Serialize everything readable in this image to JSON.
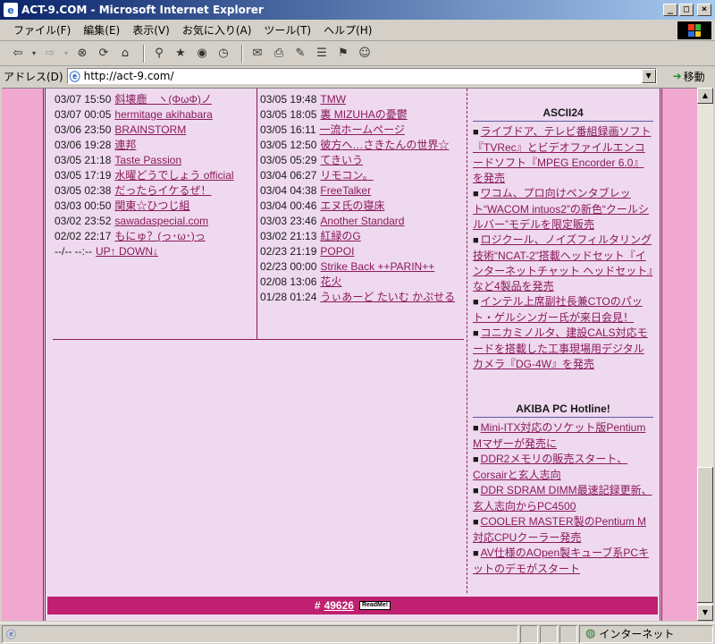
{
  "window": {
    "title": "ACT-9.COM - Microsoft Internet Explorer",
    "icon": "e"
  },
  "menu": [
    "ファイル(F)",
    "編集(E)",
    "表示(V)",
    "お気に入り(A)",
    "ツール(T)",
    "ヘルプ(H)"
  ],
  "address": {
    "label": "アドレス(D)",
    "url": "http://act-9.com/",
    "go_label": "移動"
  },
  "left_list": [
    {
      "date": "03/07 15:50",
      "link": "斜壊鹿　ヽ(ΦωΦ)ノ"
    },
    {
      "date": "03/07 00:05",
      "link": "hermitage akihabara"
    },
    {
      "date": "03/06 23:50",
      "link": "BRAINSTORM"
    },
    {
      "date": "03/06 19:28",
      "link": "連邦"
    },
    {
      "date": "03/05 21:18",
      "link": "Taste Passion"
    },
    {
      "date": "03/05 17:19",
      "link": "水曜どうでしょう official"
    },
    {
      "date": "03/05 02:38",
      "link": "だったらイケるぜ！"
    },
    {
      "date": "03/03 00:50",
      "link": "関東☆ひつじ組"
    },
    {
      "date": "03/02 23:52",
      "link": "sawadaspecial.com"
    },
    {
      "date": "02/02 22:17",
      "link": "もにゅ？(っ･ω･)っ"
    },
    {
      "date": "--/-- --:--",
      "link": "UP↑ DOWN↓"
    }
  ],
  "mid_list": [
    {
      "date": "03/05 19:48",
      "link": "TMW"
    },
    {
      "date": "03/05 18:05",
      "link": "裏 MIZUHAの憂鬱"
    },
    {
      "date": "03/05 16:11",
      "link": "一流ホームページ"
    },
    {
      "date": "03/05 12:50",
      "link": "彼方へ…さきたんの世界☆"
    },
    {
      "date": "03/05 05:29",
      "link": "てきいう"
    },
    {
      "date": "03/04 06:27",
      "link": "リモコン。"
    },
    {
      "date": "03/04 04:38",
      "link": "FreeTalker"
    },
    {
      "date": "03/04 00:46",
      "link": "エヌ氏の寝床"
    },
    {
      "date": "03/03 23:46",
      "link": "Another Standard"
    },
    {
      "date": "03/02 21:13",
      "link": "紅緑のG"
    },
    {
      "date": "02/23 21:19",
      "link": "POPOI"
    },
    {
      "date": "02/23 00:00",
      "link": "Strike Back ++PARIN++"
    },
    {
      "date": "02/08 13:06",
      "link": "花火"
    },
    {
      "date": "01/28 01:24",
      "link": "うぃあーど たいむ かぷせる"
    }
  ],
  "ascii24": {
    "title": "ASCII24",
    "items": [
      "ライブドア、テレビ番組録画ソフト『TVRec』とビデオファイルエンコードソフト『MPEG Encorder 6.0』を発売",
      "ワコム、プロ向けペンタブレット“WACOM intuos2”の新色“クールシルバー”モデルを限定販売",
      "ロジクール、ノイズフィルタリング技術“NCAT-2”搭載ヘッドセット『インターネットチャット ヘッドセット』など4製品を発売",
      "インテル上席副社長兼CTOのパット・ゲルシンガー氏が来日会見！",
      "コニカミノルタ、建設CALS対応モードを搭載した工事現場用デジタルカメラ『DG-4W』を発売"
    ]
  },
  "akiba": {
    "title": "AKIBA PC Hotline!",
    "items": [
      "Mini-ITX対応のソケット版Pentium Mマザーが発売に",
      "DDR2メモリの販売スタート、Corsairと玄人志向",
      "DDR SDRAM DIMM最速記録更新、玄人志向からPC4500",
      "COOLER MASTER製のPentium M対応CPUクーラー発売",
      "AV仕様のAOpen製キューブ系PCキットのデモがスタート"
    ]
  },
  "footer": {
    "hash": "#",
    "count": "49626",
    "badge": "ReadMe!"
  },
  "status": {
    "zone": "インターネット"
  }
}
